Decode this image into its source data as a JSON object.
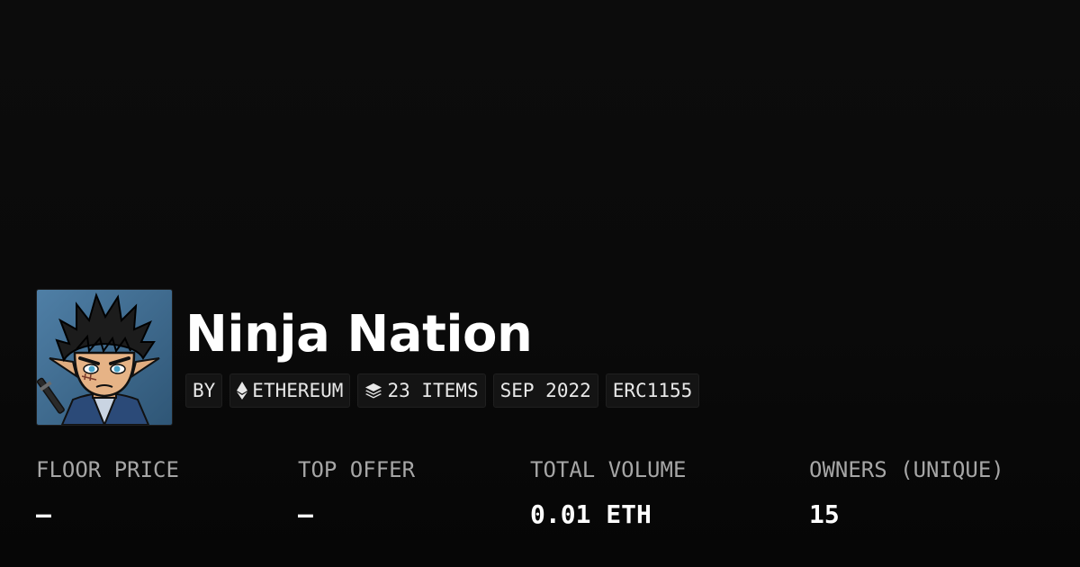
{
  "collection": {
    "name": "Ninja Nation",
    "avatar_icon": "ninja-avatar-image"
  },
  "tags": [
    {
      "label": "BY",
      "icon": null
    },
    {
      "label": "ETHEREUM",
      "icon": "ethereum-icon"
    },
    {
      "label": "23 ITEMS",
      "icon": "layers-icon"
    },
    {
      "label": "SEP 2022",
      "icon": null
    },
    {
      "label": "ERC1155",
      "icon": null
    }
  ],
  "stats": [
    {
      "label": "FLOOR PRICE",
      "value": "–"
    },
    {
      "label": "TOP OFFER",
      "value": "–"
    },
    {
      "label": "TOTAL VOLUME",
      "value": "0.01 ETH"
    },
    {
      "label": "OWNERS (UNIQUE)",
      "value": "15"
    }
  ],
  "colors": {
    "background": "#0b0b0b",
    "text_primary": "#ffffff",
    "text_secondary": "#a6a6a6",
    "tag_background": "#141414"
  }
}
